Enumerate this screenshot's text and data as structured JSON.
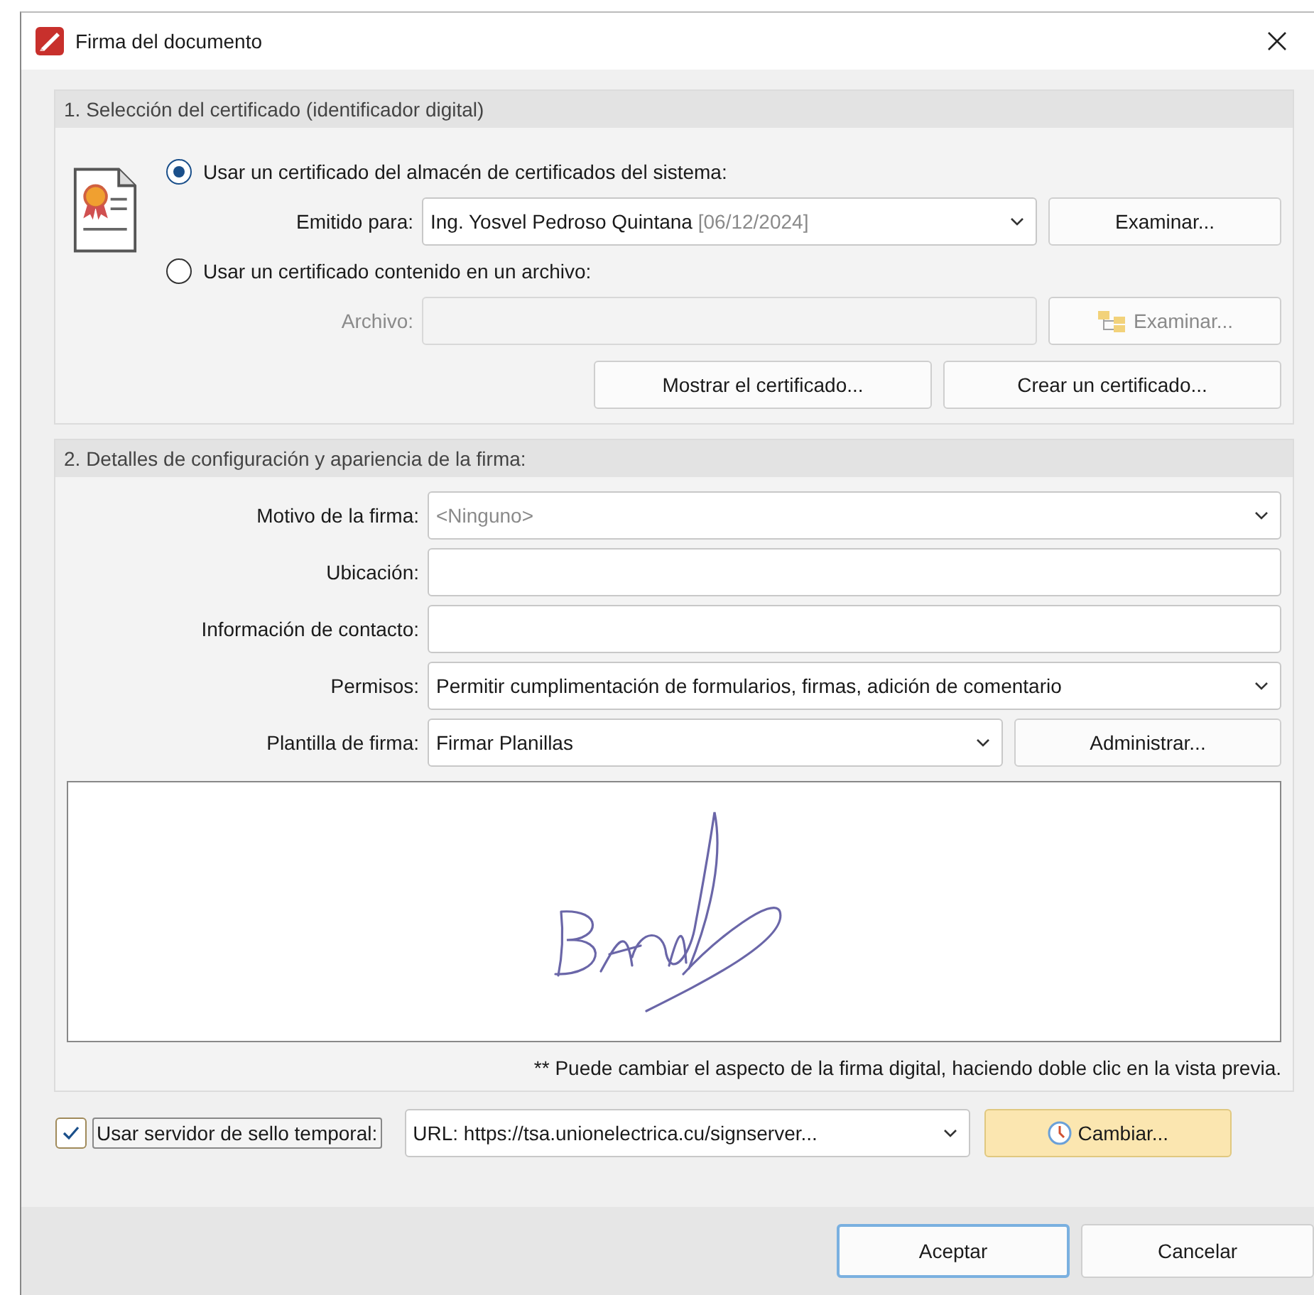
{
  "window": {
    "title": "Firma del documento"
  },
  "certificate_section": {
    "title": "1. Selección del certificado (identificador digital)",
    "options": [
      {
        "label": "Usar un certificado del almacén de certificados del sistema:",
        "selected": true,
        "field_label": "Emitido para:",
        "kind": "combo",
        "value": "Ing. Yosvel Pedroso Quintana",
        "value_note": "[06/12/2024]",
        "button": "Examinar...",
        "disabled": false,
        "icon": false
      },
      {
        "label": "Usar un certificado contenido en un archivo:",
        "selected": false,
        "field_label": "Archivo:",
        "kind": "text",
        "button": "Examinar...",
        "disabled": true,
        "icon": true
      }
    ],
    "buttons": [
      "Mostrar el certificado...",
      "Crear un certificado..."
    ]
  },
  "details_section": {
    "title": "2. Detalles de configuración y apariencia de la firma:",
    "fields": [
      {
        "kind": "combo",
        "label": "Motivo de la firma:",
        "placeholder": "<Ninguno>"
      },
      {
        "kind": "text",
        "label": "Ubicación:"
      },
      {
        "kind": "text",
        "label": "Información de contacto:"
      },
      {
        "kind": "combo",
        "label": "Permisos:",
        "value": "Permitir cumplimentación de formularios, firmas, adición de comentario"
      },
      {
        "kind": "combo_button",
        "label": "Plantilla de firma:",
        "value": "Firmar Planillas",
        "button": "Administrar..."
      }
    ],
    "note": "** Puede cambiar el aspecto de la firma digital, haciendo doble clic en la vista previa."
  },
  "timestamp": {
    "checked": true,
    "label": "Usar servidor de sello temporal:",
    "url": "URL: https://tsa.unionelectrica.cu/signserver...",
    "button": "Cambiar..."
  },
  "buttons": [
    "Aceptar",
    "Cancelar"
  ]
}
